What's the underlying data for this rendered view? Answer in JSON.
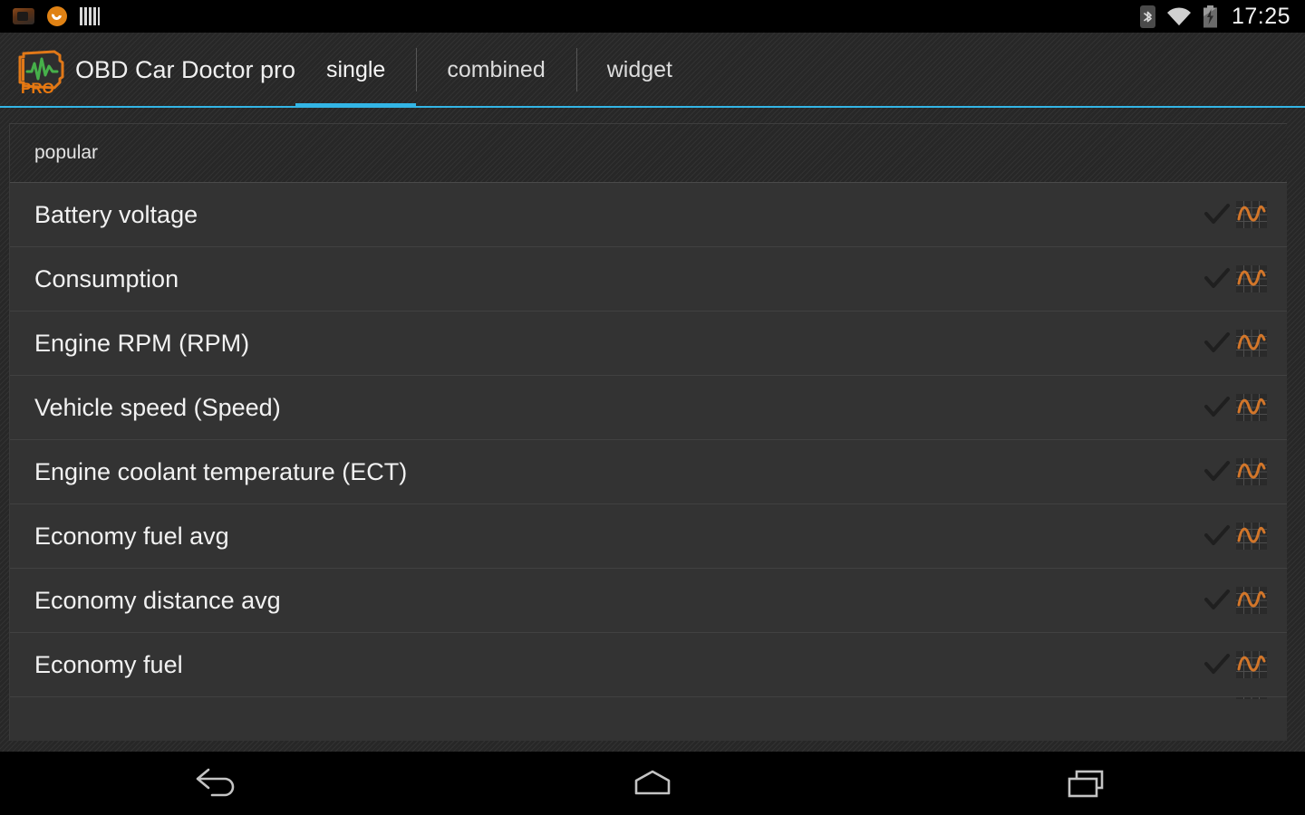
{
  "status_bar": {
    "notifications": [
      {
        "icon": "camera-icon"
      },
      {
        "icon": "sync-icon"
      },
      {
        "icon": "equalizer-bars-icon"
      }
    ],
    "bluetooth_icon": "bluetooth-icon",
    "wifi_icon": "wifi-icon",
    "battery_icon": "battery-charging-icon",
    "clock": "17:25"
  },
  "action_bar": {
    "logo_icon": "obd-connector-logo-icon",
    "logo_badge": "PRO",
    "title": "OBD Car Doctor pro",
    "tabs": [
      {
        "label": "single",
        "active": true
      },
      {
        "label": "combined",
        "active": false
      },
      {
        "label": "widget",
        "active": false
      }
    ],
    "accent_color": "#33b5e5"
  },
  "list": {
    "section_header": "popular",
    "rows": [
      {
        "label": "Battery voltage",
        "check_icon": "check-icon",
        "chart_icon": "chart-waveform-icon"
      },
      {
        "label": "Consumption",
        "check_icon": "check-icon",
        "chart_icon": "chart-waveform-icon"
      },
      {
        "label": "Engine RPM (RPM)",
        "check_icon": "check-icon",
        "chart_icon": "chart-waveform-icon"
      },
      {
        "label": "Vehicle speed (Speed)",
        "check_icon": "check-icon",
        "chart_icon": "chart-waveform-icon"
      },
      {
        "label": "Engine coolant temperature (ECT)",
        "check_icon": "check-icon",
        "chart_icon": "chart-waveform-icon"
      },
      {
        "label": "Economy fuel avg",
        "check_icon": "check-icon",
        "chart_icon": "chart-waveform-icon"
      },
      {
        "label": "Economy distance avg",
        "check_icon": "check-icon",
        "chart_icon": "chart-waveform-icon"
      },
      {
        "label": "Economy fuel",
        "check_icon": "check-icon",
        "chart_icon": "chart-waveform-icon"
      }
    ],
    "clipped_row_label": "..",
    "chart_icon_color": "#d2762a"
  },
  "nav_bar": {
    "back": "back-icon",
    "home": "home-icon",
    "recents": "recents-icon"
  }
}
